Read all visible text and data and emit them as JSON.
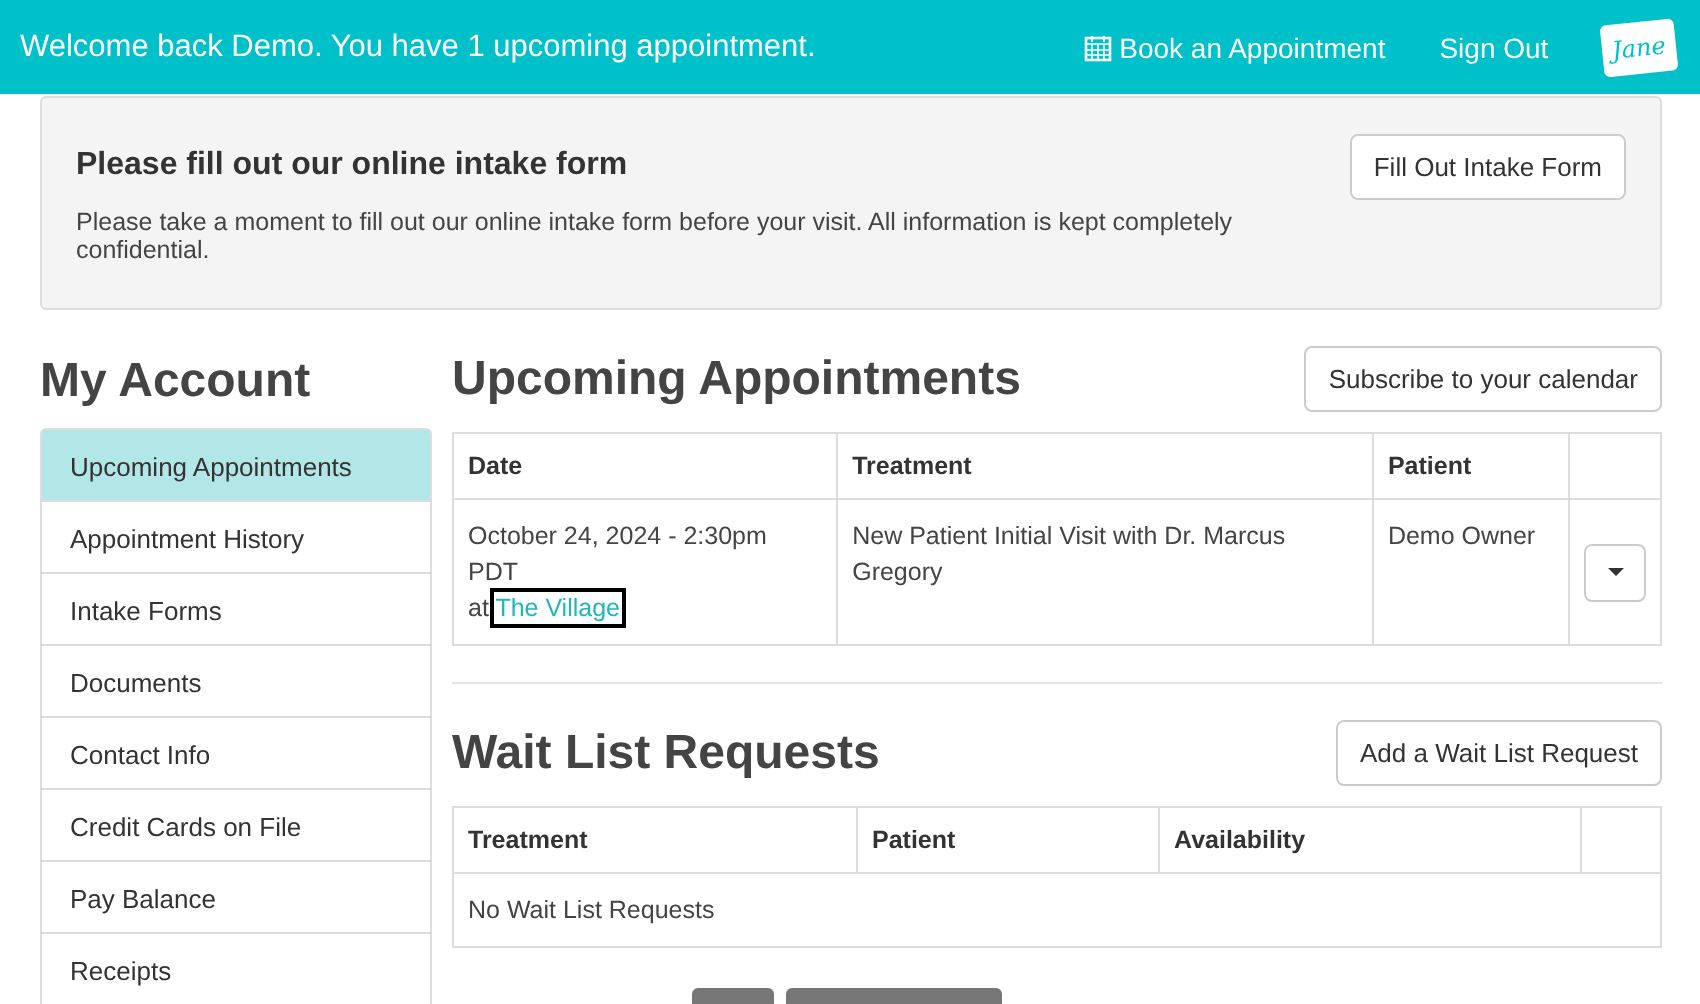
{
  "header": {
    "welcome": "Welcome back Demo. You have 1 upcoming appointment.",
    "book_link": "Book an Appointment",
    "sign_out": "Sign Out",
    "logo": "Jane"
  },
  "intake": {
    "title": "Please fill out our online intake form",
    "text": "Please take a moment to fill out our online intake form before your visit. All information is kept completely confidential.",
    "button": "Fill Out Intake Form"
  },
  "sidebar": {
    "title": "My Account",
    "items": [
      {
        "label": "Upcoming Appointments",
        "selected": true
      },
      {
        "label": "Appointment History",
        "selected": false
      },
      {
        "label": "Intake Forms",
        "selected": false
      },
      {
        "label": "Documents",
        "selected": false
      },
      {
        "label": "Contact Info",
        "selected": false
      },
      {
        "label": "Credit Cards on File",
        "selected": false
      },
      {
        "label": "Pay Balance",
        "selected": false
      },
      {
        "label": "Receipts",
        "selected": false
      }
    ]
  },
  "appointments": {
    "title": "Upcoming Appointments",
    "subscribe_button": "Subscribe to your calendar",
    "columns": [
      "Date",
      "Treatment",
      "Patient"
    ],
    "rows": [
      {
        "date": "October 24, 2024 - 2:30pm PDT",
        "at": "at",
        "location": "The Village",
        "location_focused": true,
        "treatment": "New Patient Initial Visit with Dr. Marcus Gregory",
        "patient": "Demo Owner"
      }
    ]
  },
  "wait_list": {
    "title": "Wait List Requests",
    "add_button": "Add a Wait List Request",
    "columns": [
      "Treatment",
      "Patient",
      "Availability"
    ],
    "empty": "No Wait List Requests"
  }
}
